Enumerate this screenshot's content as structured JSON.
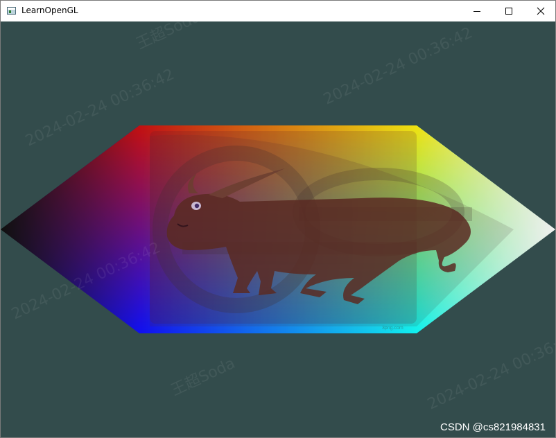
{
  "window": {
    "title": "LearnOpenGL",
    "icon": "app-window-icon",
    "controls": [
      "minimize-icon",
      "maximize-icon",
      "close-icon"
    ]
  },
  "viewport": {
    "clear_color": "#334c4c",
    "shape": "hexagon",
    "vertex_colors": {
      "left": "#000000",
      "top_left": "#ff0000",
      "top_right": "#ffff00",
      "right": "#ffffff",
      "bottom_right": "#00ffff",
      "bottom_left": "#0000ff"
    },
    "texture_subject": "cartoon bull with long horns",
    "texture_caption": "3png.com",
    "watermark_text": [
      "2024-02-24 00:36:42",
      "王超Soda"
    ]
  },
  "credit": "CSDN @cs821984831"
}
